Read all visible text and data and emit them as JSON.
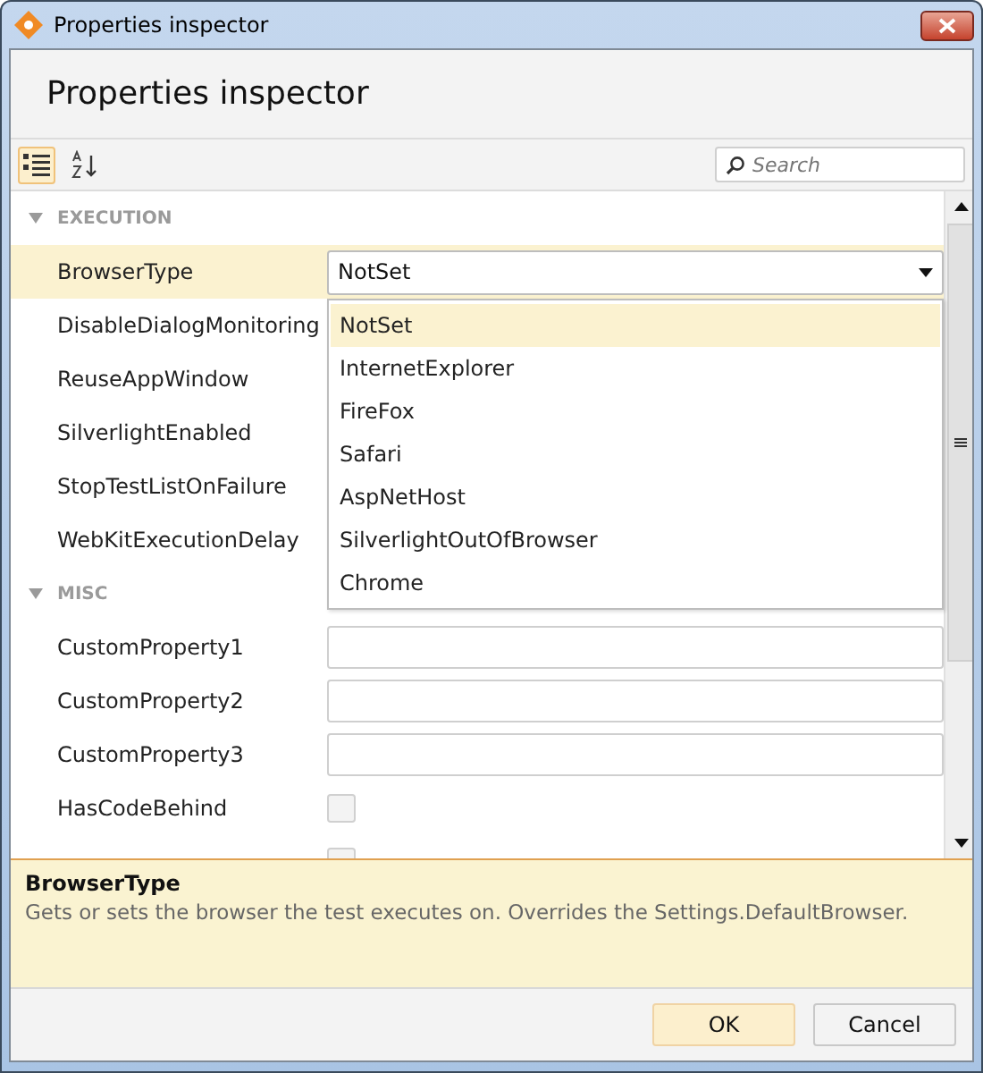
{
  "window": {
    "title": "Properties inspector"
  },
  "heading": "Properties inspector",
  "toolbar": {
    "buttons": [
      {
        "kind": "categorized",
        "selected": true
      },
      {
        "kind": "alphabetical",
        "selected": false
      }
    ],
    "search": {
      "placeholder": "Search"
    }
  },
  "categories": [
    {
      "name": "EXECUTION",
      "expanded": true,
      "properties": [
        {
          "label": "BrowserType",
          "kind": "combo",
          "value": "NotSet",
          "selected": true
        },
        {
          "label": "DisableDialogMonitoring",
          "selected": false
        },
        {
          "label": "ReuseAppWindow",
          "selected": false
        },
        {
          "label": "SilverlightEnabled",
          "selected": false
        },
        {
          "label": "StopTestListOnFailure",
          "selected": false
        },
        {
          "label": "WebKitExecutionDelay",
          "selected": false
        }
      ]
    },
    {
      "name": "MISC",
      "expanded": true,
      "properties": [
        {
          "label": "CustomProperty1",
          "kind": "text",
          "selected": false
        },
        {
          "label": "CustomProperty2",
          "kind": "text",
          "selected": false
        },
        {
          "label": "CustomProperty3",
          "kind": "text",
          "selected": false
        },
        {
          "label": "HasCodeBehind",
          "kind": "checkbox",
          "checked": false,
          "selected": false
        },
        {
          "kind": "checkbox",
          "selected": false
        }
      ]
    }
  ],
  "dropdown": {
    "options": [
      {
        "label": "NotSet",
        "selected": true
      },
      {
        "label": "InternetExplorer",
        "selected": false
      },
      {
        "label": "FireFox",
        "selected": false
      },
      {
        "label": "Safari",
        "selected": false
      },
      {
        "label": "AspNetHost",
        "selected": false
      },
      {
        "label": "SilverlightOutOfBrowser",
        "selected": false
      },
      {
        "label": "Chrome",
        "selected": false
      }
    ]
  },
  "description": {
    "title": "BrowserType",
    "text": "Gets or sets the browser the test executes on. Overrides the Settings.DefaultBrowser."
  },
  "buttons": [
    {
      "label": "OK",
      "kind": "primary"
    },
    {
      "label": "Cancel",
      "kind": "secondary"
    }
  ]
}
